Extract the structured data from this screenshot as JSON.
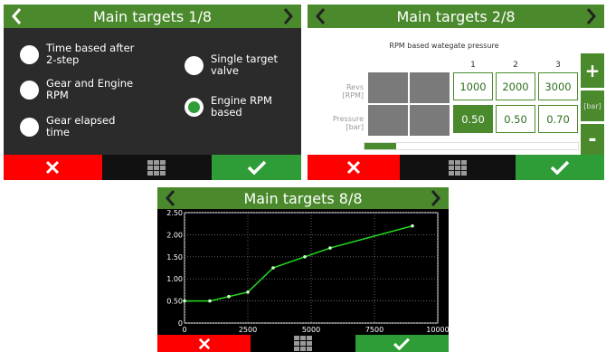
{
  "panel1": {
    "title": "Main targets 1/8",
    "options": [
      {
        "label": "Time based after 2-step",
        "selected": false
      },
      {
        "label": "Gear and Engine RPM",
        "selected": false
      },
      {
        "label": "Gear elapsed time",
        "selected": false
      },
      {
        "label": "Single target valve",
        "selected": false
      },
      {
        "label": "Engine RPM based",
        "selected": true
      }
    ]
  },
  "panel2": {
    "title": "Main targets 2/8",
    "subtitle": "RPM based wategate pressure",
    "row_revs": {
      "name": "Revs",
      "unit": "[RPM]"
    },
    "row_pressure": {
      "name": "Pressure",
      "unit": "[bar]"
    },
    "columns": [
      "1",
      "2",
      "3"
    ],
    "revs": [
      "1000",
      "2000",
      "3000"
    ],
    "pressure": [
      "0.50",
      "0.50",
      "0.70"
    ],
    "plus": "+",
    "minus": "-",
    "unit_label": "[bar]",
    "progress": 0.15
  },
  "panel3": {
    "title": "Main targets 8/8"
  },
  "colors": {
    "header": "#4a8a2c",
    "cancel": "#ff0000",
    "confirm": "#2f9d37",
    "line": "#22dd22"
  },
  "chart_data": {
    "type": "line",
    "x": [
      0,
      1000,
      1750,
      2500,
      3500,
      4750,
      5750,
      9000
    ],
    "y": [
      0.5,
      0.5,
      0.6,
      0.7,
      1.25,
      1.5,
      1.7,
      2.2
    ],
    "xticks": [
      "0",
      "2500",
      "5000",
      "7500",
      "10000"
    ],
    "yticks": [
      "0",
      "0.50",
      "1.00",
      "1.50",
      "2.00",
      "2.50"
    ],
    "xlim": [
      0,
      10000
    ],
    "ylim": [
      0,
      2.5
    ],
    "grid": true
  }
}
